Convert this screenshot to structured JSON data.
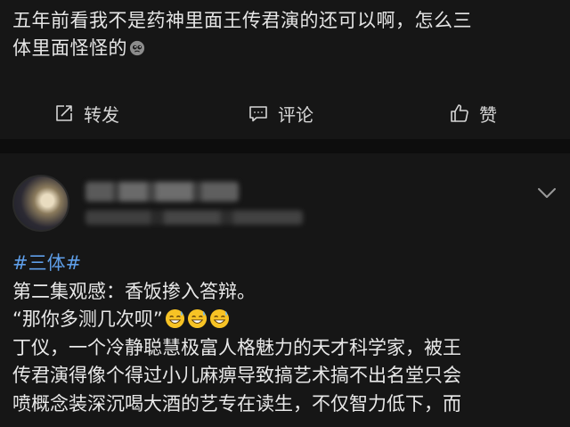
{
  "post1": {
    "text_line1": "五年前看我不是药神里面王传君演的还可以啊，怎么三",
    "text_line2": "体里面怪怪的"
  },
  "actions": {
    "repost_label": "转发",
    "comment_label": "评论",
    "like_label": "赞"
  },
  "post2": {
    "hashtag": "#三体#",
    "line2": "第二集观感：香饭掺入答辩。",
    "line3": "“那你多测几次呗”",
    "line4": "丁仪，一个冷静聪慧极富人格魅力的天才科学家，被王",
    "line5": "传君演得像个得过小儿麻痹导致搞艺术搞不出名堂只会",
    "line6": "喷概念装深沉喝大酒的艺专在读生，不仅智力低下，而"
  },
  "colors": {
    "background": "#161616",
    "divider": "#0d0d0d",
    "text": "#e8e8e8",
    "hashtag": "#5e9ee8"
  }
}
